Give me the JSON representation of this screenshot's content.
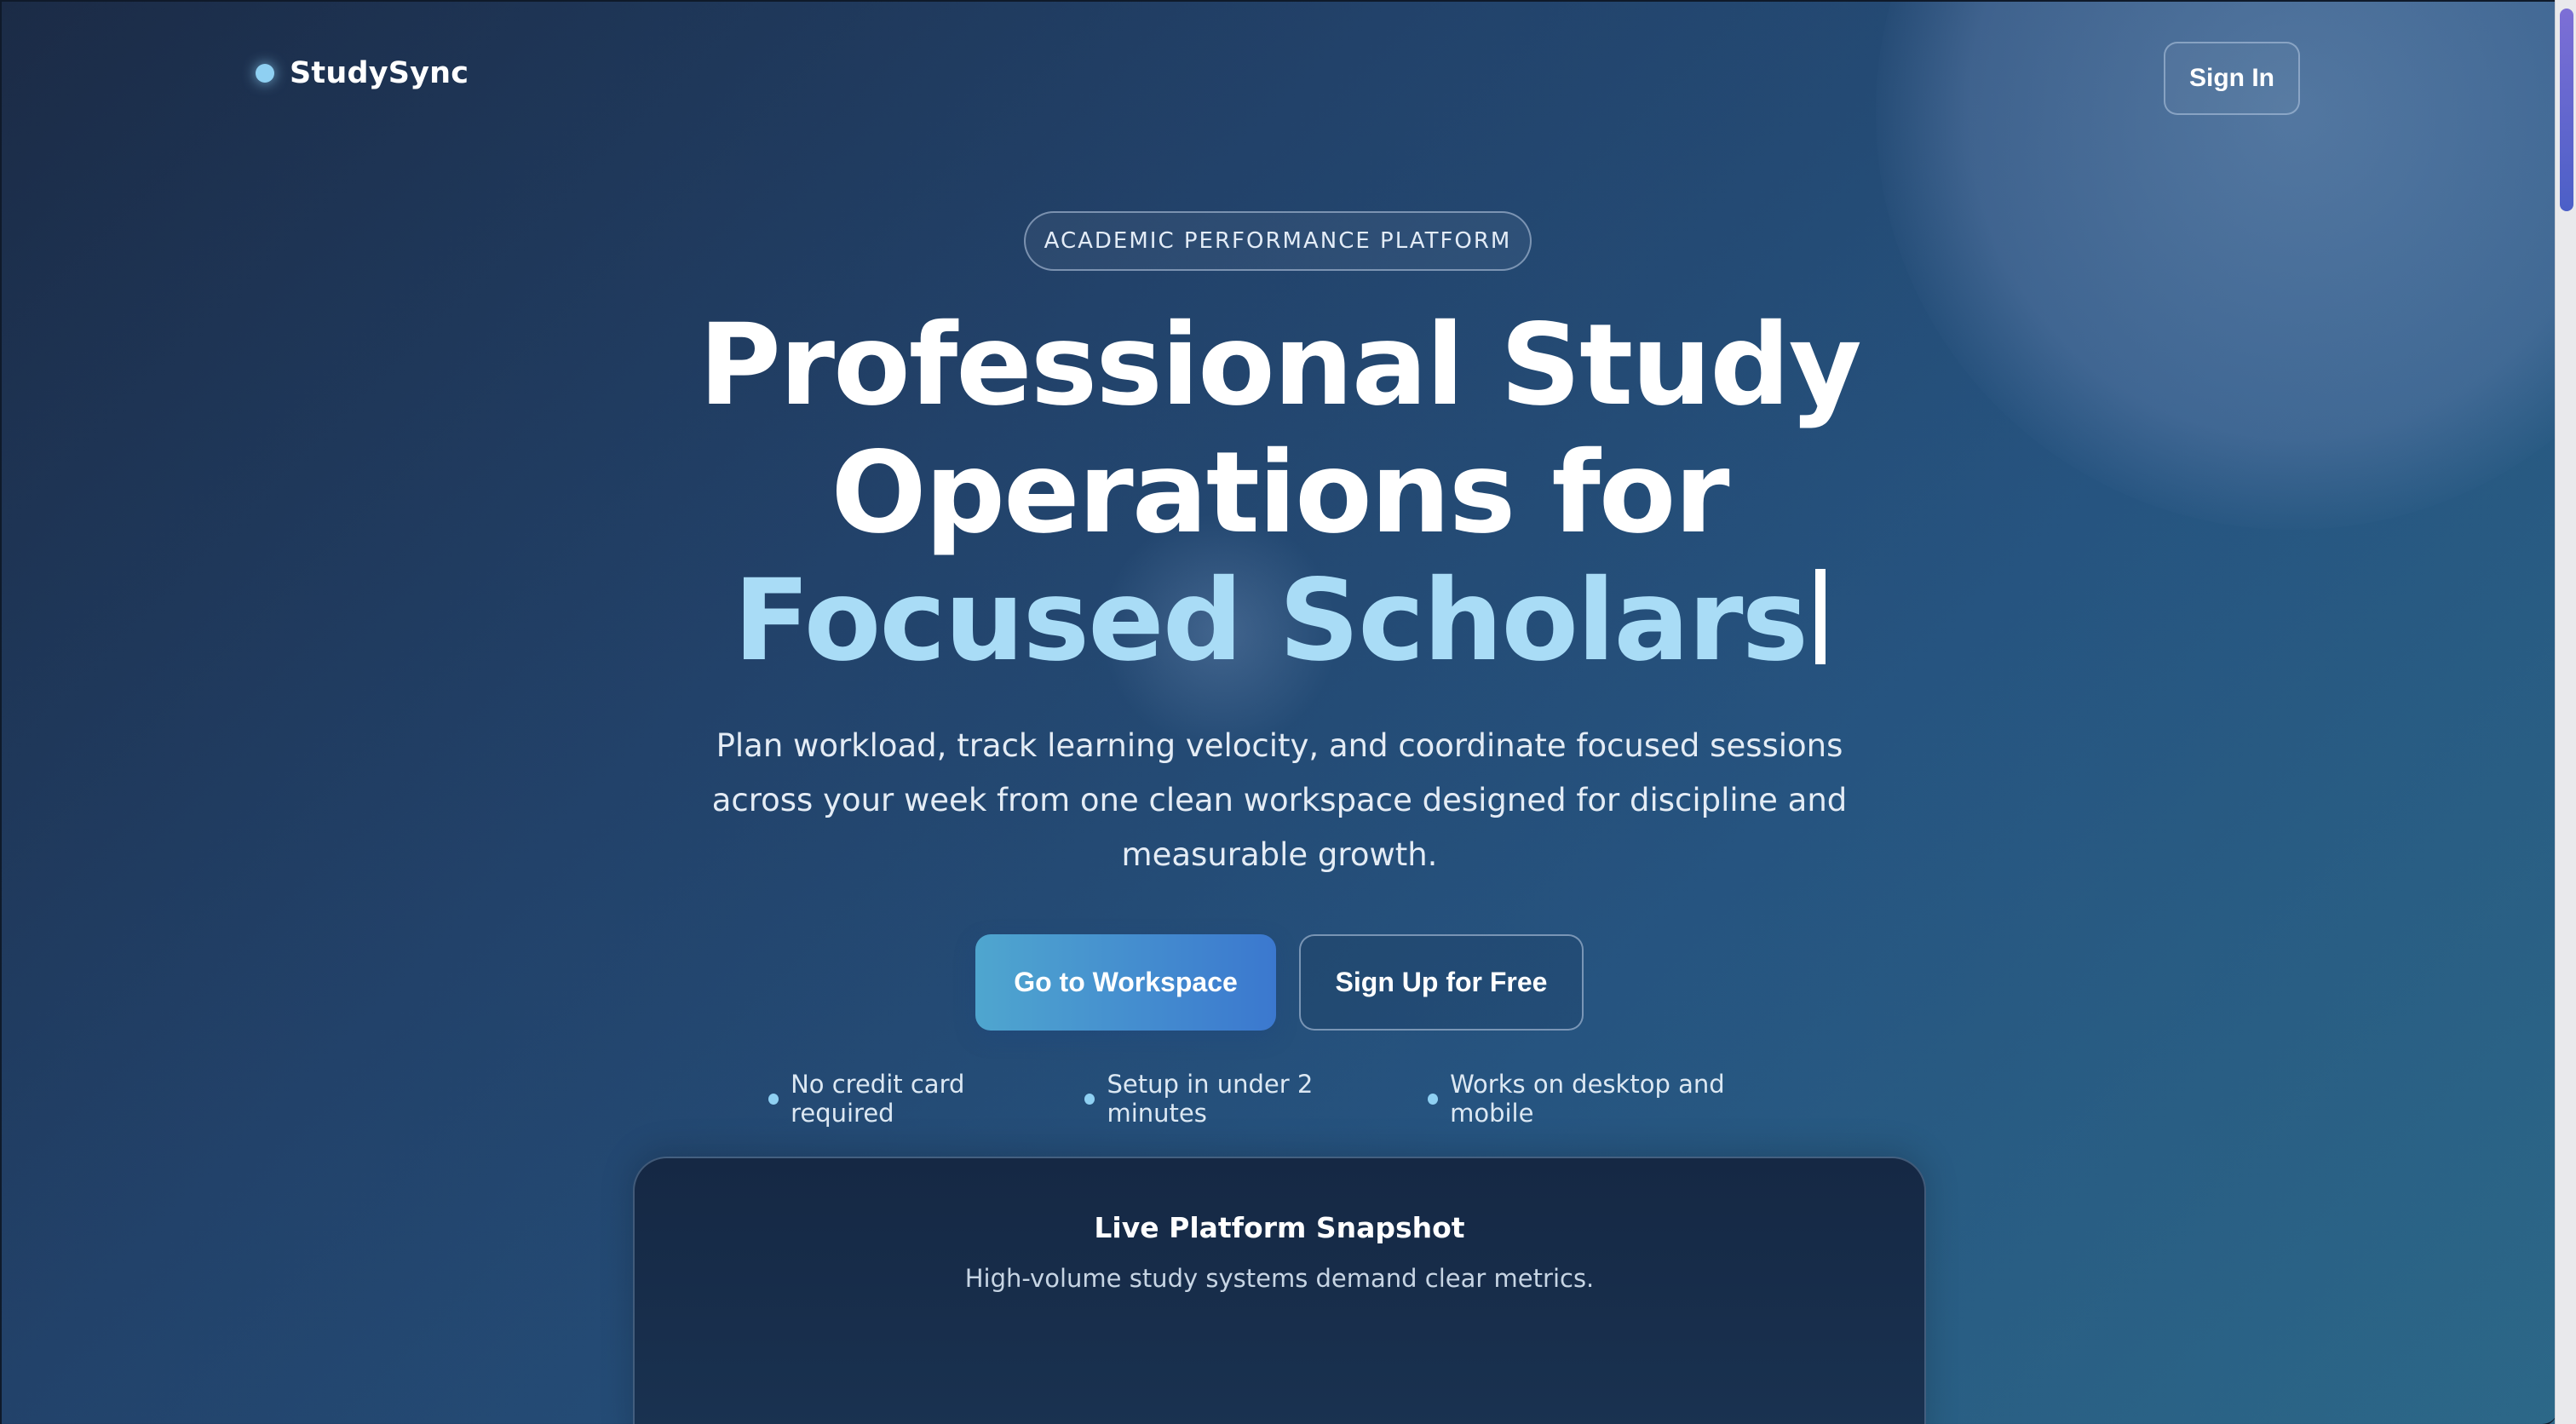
{
  "header": {
    "brand": "StudySync",
    "sign_in_label": "Sign In"
  },
  "hero": {
    "eyebrow": "ACADEMIC PERFORMANCE PLATFORM",
    "title_line_1": "Professional Study",
    "title_line_2": "Operations for",
    "title_accent": "Focused Scholars",
    "subtitle": "Plan workload, track learning velocity, and coordinate focused sessions across your week from one clean workspace designed for discipline and measurable growth.",
    "primary_cta": "Go to Workspace",
    "secondary_cta": "Sign Up for Free",
    "perks": [
      "No credit card required",
      "Setup in under 2 minutes",
      "Works on desktop and mobile"
    ]
  },
  "snapshot": {
    "title": "Live Platform Snapshot",
    "subtitle": "High-volume study systems demand clear metrics."
  },
  "colors": {
    "accent": "#a9dcf6",
    "brand_dot": "#8fd0f2",
    "primary_button_start": "#4fa6cf",
    "primary_button_end": "#3b78cf",
    "background_dark": "#1b2b46",
    "background_light": "#2c6888"
  }
}
